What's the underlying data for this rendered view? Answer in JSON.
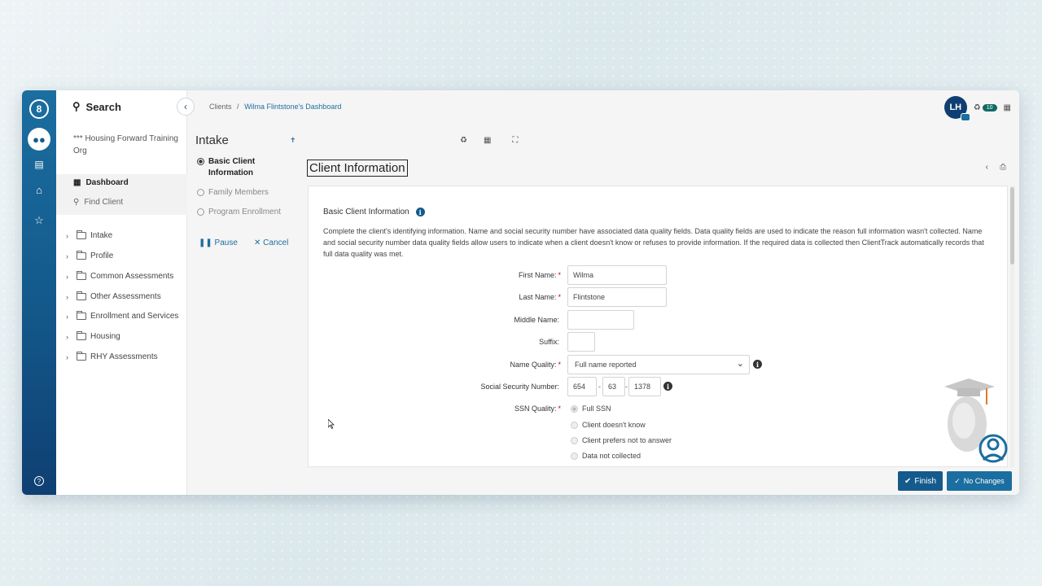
{
  "nav": {
    "search_label": "Search",
    "org": "*** Housing Forward Training Org",
    "dashboard": "Dashboard",
    "find_client": "Find Client",
    "folders": [
      "Intake",
      "Profile",
      "Common Assessments",
      "Other Assessments",
      "Enrollment and Services",
      "Housing",
      "RHY Assessments"
    ]
  },
  "breadcrumb": {
    "root": "Clients",
    "sep": "/",
    "current": "Wilma Flintstone's Dashboard"
  },
  "header": {
    "avatar_initials": "LH",
    "notification_count": "10"
  },
  "workflow": {
    "title": "Intake",
    "steps": [
      "Basic Client Information",
      "Family Members",
      "Program Enrollment"
    ],
    "pause": "Pause",
    "cancel": "Cancel"
  },
  "form": {
    "title": "Client Information",
    "section": "Basic Client Information",
    "description": "Complete the client's identifying information. Name and social security number have associated data quality fields. Data quality fields are used to indicate the reason full information wasn't collected. Name and social security number data quality fields allow users to indicate when a client doesn't know or refuses to provide information. If the required data is collected then ClientTrack automatically records that full data quality was met.",
    "labels": {
      "first_name": "First Name:",
      "last_name": "Last Name:",
      "middle_name": "Middle Name:",
      "suffix": "Suffix:",
      "name_quality": "Name Quality:",
      "ssn": "Social Security Number:",
      "ssn_quality": "SSN Quality:"
    },
    "values": {
      "first_name": "Wilma",
      "last_name": "Flintstone",
      "middle_name": "",
      "suffix": "",
      "name_quality": "Full name reported",
      "ssn_1": "654",
      "ssn_2": "63",
      "ssn_3": "1378"
    },
    "ssn_quality_options": [
      "Full SSN",
      "Client doesn't know",
      "Client prefers not to answer",
      "Data not collected"
    ],
    "ssn_quality_selected": "Full SSN"
  },
  "buttons": {
    "finish": "Finish",
    "no_changes": "No Changes"
  },
  "colors": {
    "rail_top": "#1b6ea0",
    "rail_bottom": "#0f3f72",
    "link": "#1e6e9e",
    "primary_button": "#145a8c",
    "badge": "#0e6b63"
  }
}
